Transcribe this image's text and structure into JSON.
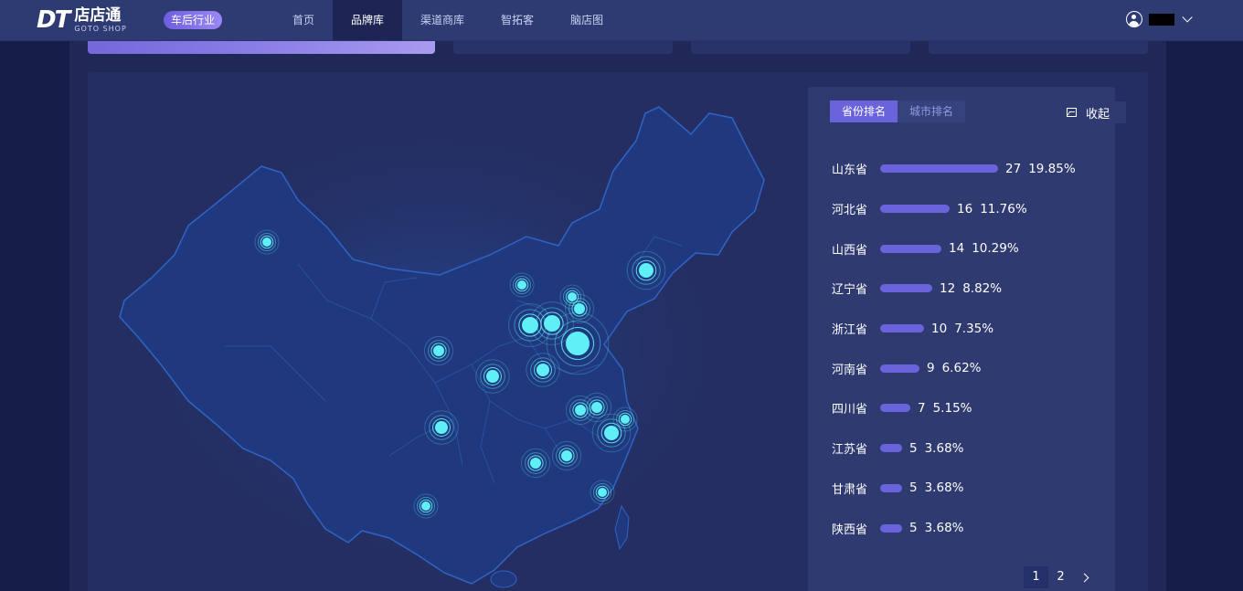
{
  "header": {
    "logo_mark": "DT",
    "logo_cn": "店店通",
    "logo_en": "GOTO SHOP",
    "industry_badge": "车后行业",
    "nav": [
      "首页",
      "品牌库",
      "渠道商库",
      "智拓客",
      "脑店图"
    ],
    "nav_active_index": 1
  },
  "rank_panel": {
    "tabs": [
      "省份排名",
      "城市排名"
    ],
    "active_tab": 0,
    "collapse_label": "收起",
    "rows": [
      {
        "name": "山东省",
        "count": "27",
        "pct": "19.85%",
        "value": 27
      },
      {
        "name": "河北省",
        "count": "16",
        "pct": "11.76%",
        "value": 16
      },
      {
        "name": "山西省",
        "count": "14",
        "pct": "10.29%",
        "value": 14
      },
      {
        "name": "辽宁省",
        "count": "12",
        "pct": "8.82%",
        "value": 12
      },
      {
        "name": "浙江省",
        "count": "10",
        "pct": "7.35%",
        "value": 10
      },
      {
        "name": "河南省",
        "count": "9",
        "pct": "6.62%",
        "value": 9
      },
      {
        "name": "四川省",
        "count": "7",
        "pct": "5.15%",
        "value": 7
      },
      {
        "name": "江苏省",
        "count": "5",
        "pct": "3.68%",
        "value": 5
      },
      {
        "name": "甘肃省",
        "count": "5",
        "pct": "3.68%",
        "value": 5
      },
      {
        "name": "陕西省",
        "count": "5",
        "pct": "3.68%",
        "value": 5
      }
    ],
    "pages": [
      "1",
      "2"
    ],
    "current_page": "1"
  },
  "colors": {
    "accent": "#6b63dc",
    "marker": "#5ef0f6",
    "map_fill": "#203a80"
  }
}
